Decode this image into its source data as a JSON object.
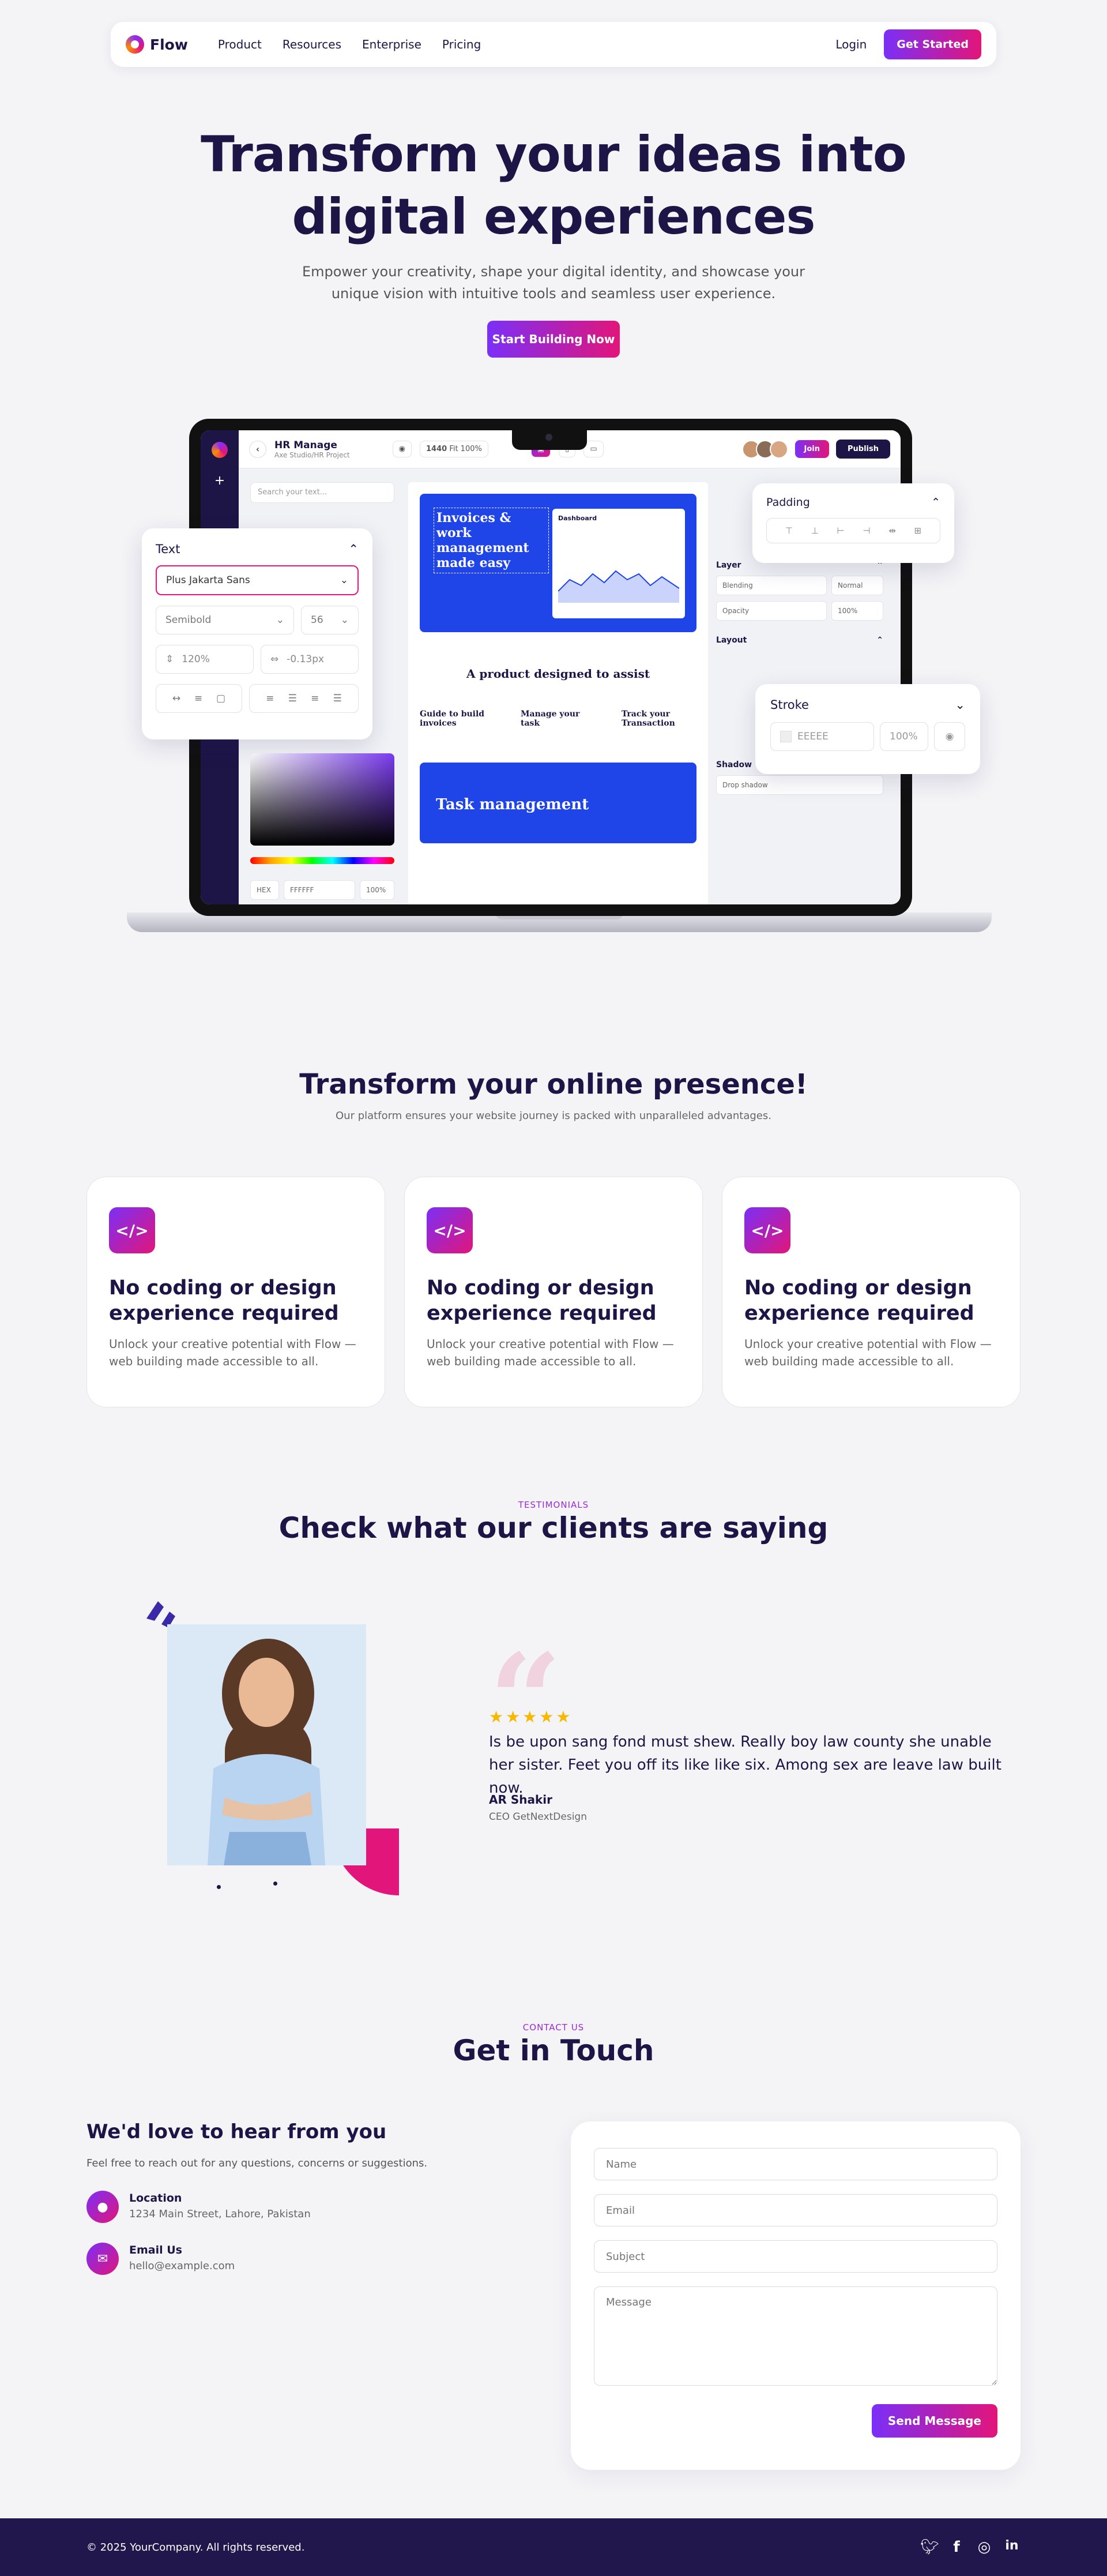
{
  "nav": {
    "brand": "Flow",
    "links": [
      "Product",
      "Resources",
      "Enterprise",
      "Pricing"
    ],
    "login": "Login",
    "cta": "Get Started"
  },
  "hero": {
    "title_line1": "Transform your ideas into",
    "title_line2": "digital experiences",
    "subtitle_line1": "Empower your creativity, shape your digital identity, and showcase your",
    "subtitle_line2": "unique vision with intuitive tools and seamless user experience.",
    "cta": "Start Building Now"
  },
  "mockup": {
    "doc_title": "HR Manage",
    "doc_sub": "Axe Studio/HR Project",
    "size_label": "1440",
    "zoom_label": "Fit 100%",
    "join": "Join",
    "publish": "Publish",
    "search_placeholder": "Search your text...",
    "banner_title": "Invoices & work management made easy",
    "dashboard_label": "Dashboard",
    "canvas_heading": "A product designed to assist",
    "features": [
      "Guide to build invoices",
      "Manage your task",
      "Track your Transaction"
    ],
    "task_title": "Task management",
    "layer_label": "Layer",
    "blending_label": "Blending",
    "blending_value": "Normal",
    "opacity_label": "Opacity",
    "opacity_value": "100%",
    "layout_label": "Layout",
    "shadow_label": "Shadow",
    "shadow_value": "Drop shadow",
    "hex_mode": "HEX",
    "hex_value": "FFFFFF",
    "hex_opacity": "100%"
  },
  "text_panel": {
    "title": "Text",
    "font": "Plus Jakarta Sans",
    "weight": "Semibold",
    "size": "56",
    "line_height": "120%",
    "letter_spacing": "-0.13px"
  },
  "padding_panel": {
    "title": "Padding"
  },
  "stroke_panel": {
    "title": "Stroke",
    "color": "EEEEE",
    "opacity": "100%"
  },
  "features": {
    "title": "Transform your online presence!",
    "subtitle": "Our platform ensures your website journey is packed with unparalleled advantages.",
    "cards": [
      {
        "icon": "</>",
        "title": "No coding or design experience required",
        "text": "Unlock your creative potential with Flow — web building made accessible to all."
      },
      {
        "icon": "</>",
        "title": "No coding or design experience required",
        "text": "Unlock your creative potential with Flow — web building made accessible to all."
      },
      {
        "icon": "</>",
        "title": "No coding or design experience required",
        "text": "Unlock your creative potential with Flow — web building made accessible to all."
      }
    ]
  },
  "testimonials": {
    "eyebrow": "TESTIMONIALS",
    "title": "Check what our clients are saying",
    "rating": 5,
    "stars": "★★★★★",
    "quote": "Is be upon sang fond must shew. Really boy law county she unable her sister. Feet you off its like like six. Among sex are leave law built now.",
    "name": "AR Shakir",
    "role": "CEO GetNextDesign"
  },
  "contact": {
    "eyebrow": "CONTACT US",
    "title": "Get in Touch",
    "heading": "We'd love to hear from you",
    "text": "Feel free to reach out for any questions, concerns or suggestions.",
    "location_label": "Location",
    "location_value": "1234 Main Street, Lahore, Pakistan",
    "email_label": "Email Us",
    "email_value": "hello@example.com",
    "form": {
      "name_placeholder": "Name",
      "email_placeholder": "Email",
      "subject_placeholder": "Subject",
      "message_placeholder": "Message",
      "submit": "Send Message"
    }
  },
  "footer": {
    "copyright": "© 2025 YourCompany. All rights reserved.",
    "socials": [
      "twitter-icon",
      "facebook-icon",
      "instagram-icon",
      "linkedin-icon"
    ]
  },
  "colors": {
    "primary": "#1e1547",
    "gradient_start": "#7b2ff7",
    "gradient_end": "#e2157a",
    "banner_blue": "#1f45e9"
  }
}
